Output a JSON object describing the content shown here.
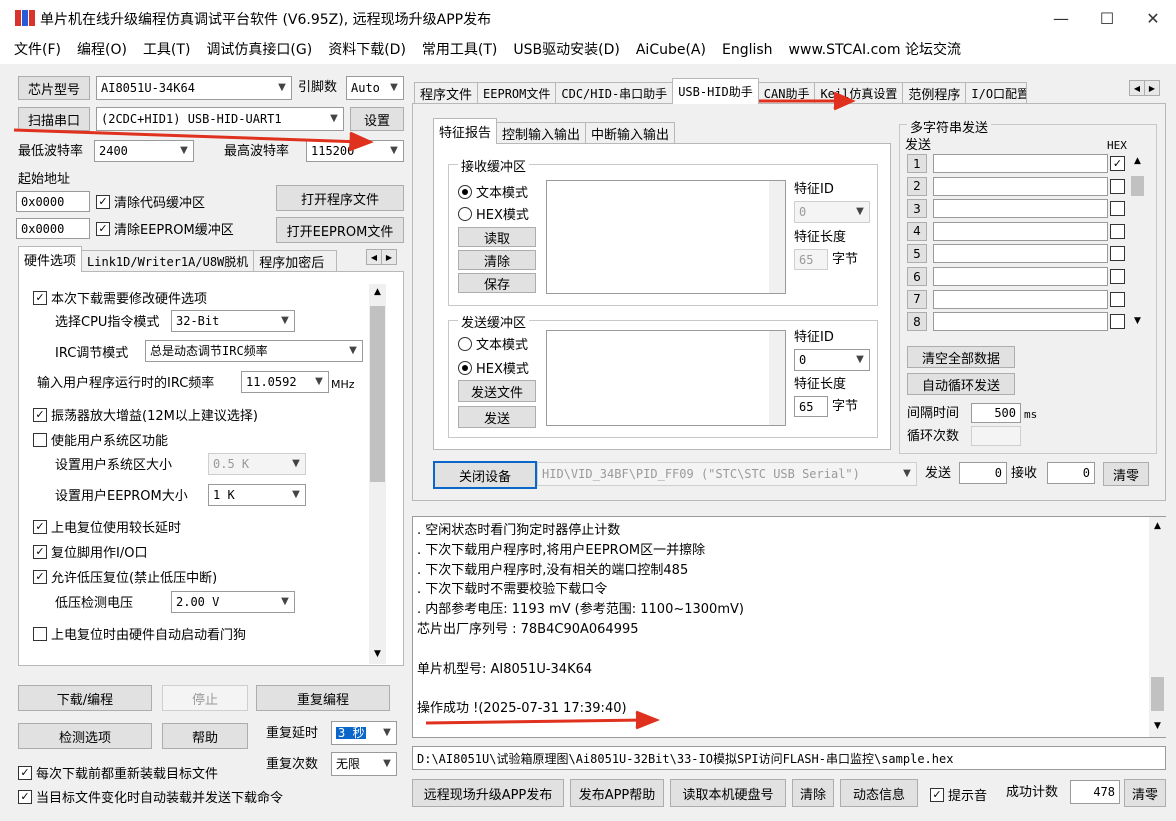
{
  "window": {
    "title": "单片机在线升级编程仿真调试平台软件 (V6.95Z), 远程现场升级APP发布",
    "minimize_glyph": "—",
    "maximize_glyph": "☐",
    "close_glyph": "✕"
  },
  "menu": [
    "文件(F)",
    "编程(O)",
    "工具(T)",
    "调试仿真接口(G)",
    "资料下载(D)",
    "常用工具(T)",
    "USB驱动安装(D)",
    "AiCube(A)",
    "English",
    "www.STCAI.com 论坛交流"
  ],
  "left": {
    "chip_type_btn": "芯片型号",
    "chip_type_value": "AI8051U-34K64",
    "pin_count_label": "引脚数",
    "pin_count_value": "Auto",
    "scan_port_btn": "扫描串口",
    "port_value": "(2CDC+HID1) USB-HID-UART1",
    "settings_btn": "设置",
    "min_baud_label": "最低波特率",
    "min_baud_value": "2400",
    "max_baud_label": "最高波特率",
    "max_baud_value": "115200",
    "start_addr_label": "起始地址",
    "addr1": "0x0000",
    "clear_code_label": "清除代码缓冲区",
    "open_prog_btn": "打开程序文件",
    "addr2": "0x0000",
    "clear_eeprom_label": "清除EEPROM缓冲区",
    "open_eeprom_btn": "打开EEPROM文件",
    "tabs": [
      "硬件选项",
      "Link1D/Writer1A/U8W脱机",
      "程序加密后"
    ],
    "hw": {
      "opt_modify": "本次下载需要修改硬件选项",
      "cpu_mode_label": "选择CPU指令模式",
      "cpu_mode_value": "32-Bit",
      "irc_mode_label": "IRC调节模式",
      "irc_mode_value": "总是动态调节IRC频率",
      "irc_freq_label": "输入用户程序运行时的IRC频率",
      "irc_freq_value": "11.0592",
      "irc_freq_unit": "MHz",
      "osc_gain": "振荡器放大增益(12M以上建议选择)",
      "user_sys": "使能用户系统区功能",
      "user_sys_size_label": "设置用户系统区大小",
      "user_sys_size_value": "0.5 K",
      "user_eeprom_label": "设置用户EEPROM大小",
      "user_eeprom_value": "1   K",
      "long_delay": "上电复位使用较长延时",
      "reset_io": "复位脚用作I/O口",
      "low_volt_reset": "允许低压复位(禁止低压中断)",
      "low_volt_label": "低压检测电压",
      "low_volt_value": "2.00 V",
      "watchdog": "上电复位时由硬件自动启动看门狗"
    },
    "download_btn": "下载/编程",
    "stop_btn": "停止",
    "reprog_btn": "重复编程",
    "check_btn": "检测选项",
    "help_btn": "帮助",
    "repeat_delay_label": "重复延时",
    "repeat_delay_value": "3 秒",
    "repeat_count_label": "重复次数",
    "repeat_count_value": "无限",
    "reload_before": "每次下载前都重新装载目标文件",
    "auto_reload": "当目标文件变化时自动装载并发送下载命令"
  },
  "right": {
    "tabs": [
      "程序文件",
      "EEPROM文件",
      "CDC/HID-串口助手",
      "USB-HID助手",
      "CAN助手",
      "Keil仿真设置",
      "范例程序",
      "I/O口配置"
    ],
    "subtabs": [
      "特征报告",
      "控制输入输出",
      "中断输入输出"
    ],
    "recv_group": "接收缓冲区",
    "text_mode": "文本模式",
    "hex_mode": "HEX模式",
    "read_btn": "读取",
    "clear_btn": "清除",
    "save_btn": "保存",
    "feature_id_label": "特征ID",
    "recv_feature_id": "0",
    "feature_len_label": "特征长度",
    "recv_feature_len": "65",
    "bytes_unit": "字节",
    "send_group": "发送缓冲区",
    "send_file_btn": "发送文件",
    "send_btn": "发送",
    "send_feature_id": "0",
    "send_feature_len": "65",
    "multi_group": "多字符串发送",
    "send_col": "发送",
    "hex_col": "HEX",
    "rows": [
      "1",
      "2",
      "3",
      "4",
      "5",
      "6",
      "7",
      "8"
    ],
    "clear_all_btn": "清空全部数据",
    "auto_loop_btn": "自动循环发送",
    "interval_label": "间隔时间",
    "interval_value": "500",
    "interval_unit": "ms",
    "loop_count_label": "循环次数",
    "close_device_btn": "关闭设备",
    "device_value": "HID\\VID_34BF\\PID_FF09 (\"STC\\STC USB Serial\")",
    "send_count_label": "发送",
    "send_count": "0",
    "recv_count_label": "接收",
    "recv_count": "0",
    "zero_btn": "清零"
  },
  "log": {
    "lines": [
      "  . 空闲状态时看门狗定时器停止计数",
      "  . 下次下载用户程序时,将用户EEPROM区一并擦除",
      "  . 下次下载用户程序时,没有相关的端口控制485",
      "  . 下次下载时不需要校验下载口令",
      "  . 内部参考电压: 1193 mV (参考范围: 1100~1300mV)",
      "芯片出厂序列号 : 78B4C90A064995",
      "",
      "  单片机型号: AI8051U-34K64",
      "",
      "操作成功 !(2025-07-31 17:39:40)"
    ]
  },
  "file_path": "D:\\AI8051U\\试验箱原理图\\Ai8051U-32Bit\\33-IO模拟SPI访问FLASH-串口监控\\sample.hex",
  "bottom": {
    "remote_btn": "远程现场升级APP发布",
    "app_help_btn": "发布APP帮助",
    "read_disk_btn": "读取本机硬盘号",
    "clear_btn": "清除",
    "dynamic_btn": "动态信息",
    "beep_label": "提示音",
    "success_label": "成功计数",
    "success_count": "478",
    "zero_btn": "清零"
  },
  "colors": {
    "accent_arrow": "#e0301e",
    "focus_border": "#0a66c8"
  }
}
